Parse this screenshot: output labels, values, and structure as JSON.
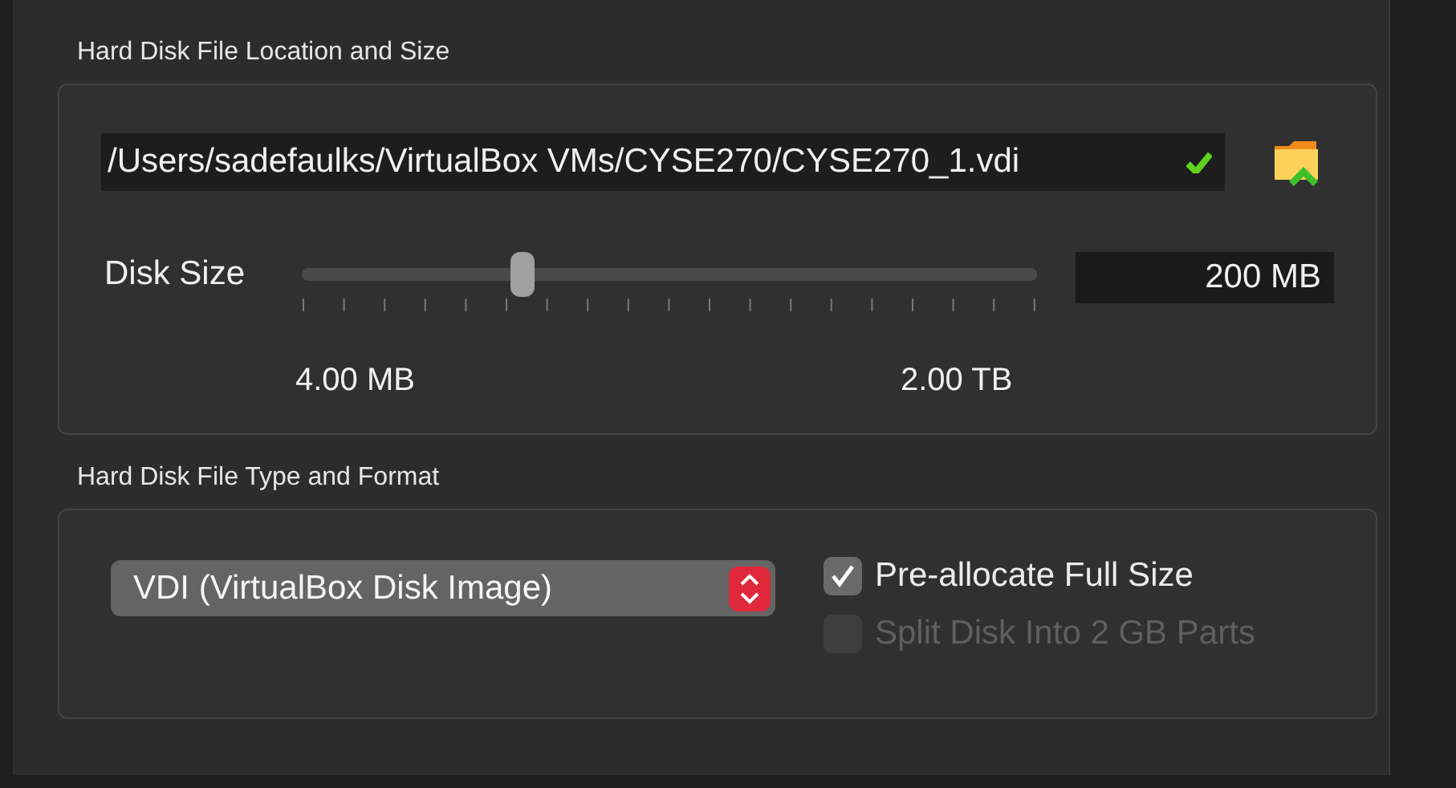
{
  "location_section": {
    "title": "Hard Disk File Location and Size",
    "path": "/Users/sadefaulks/VirtualBox VMs/CYSE270/CYSE270_1.vdi",
    "path_valid": true,
    "size_label": "Disk Size",
    "size_slider": {
      "level": 0.3
    },
    "size_value": "200 MB",
    "min_label": "4.00 MB",
    "max_label": "2.00 TB"
  },
  "format_section": {
    "title": "Hard Disk File Type and Format",
    "format": "VDI (VirtualBox Disk Image)",
    "options": [
      {
        "label": "Pre-allocate Full Size",
        "checked": true,
        "disabled": false
      },
      {
        "label": "Split Disk Into 2 GB Parts",
        "checked": false,
        "disabled": true
      }
    ]
  }
}
